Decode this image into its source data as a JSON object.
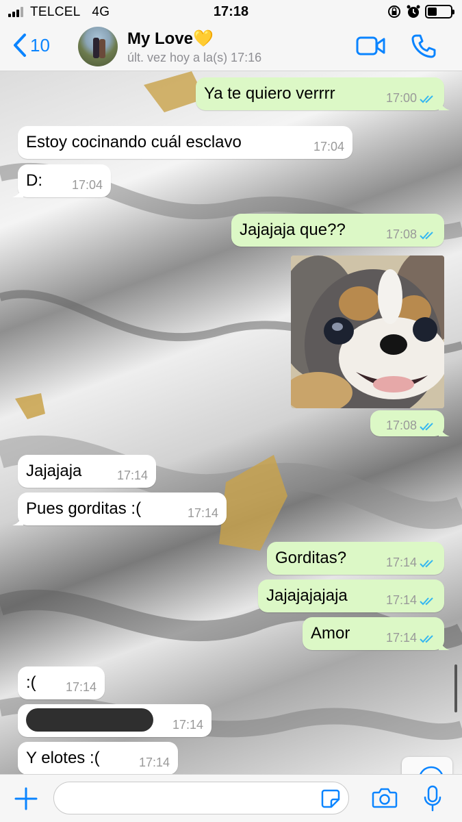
{
  "status_bar": {
    "carrier": "TELCEL",
    "network": "4G",
    "time": "17:18",
    "battery_level": 0.3
  },
  "header": {
    "back_count": "10",
    "contact_name": "My Love💛",
    "last_seen": "últ. vez hoy a la(s) 17:16",
    "icons": [
      "chevron-left-icon",
      "video-call-icon",
      "phone-call-icon"
    ]
  },
  "messages": [
    {
      "dir": "out",
      "text": "Ya te quiero verrrr",
      "time": "17:00",
      "read": true
    },
    {
      "dir": "in",
      "text": "Estoy cocinando cuál esclavo",
      "time": "17:04"
    },
    {
      "dir": "in",
      "text": "D:",
      "time": "17:04"
    },
    {
      "dir": "out",
      "text": "Jajajaja que??",
      "time": "17:08",
      "read": true
    },
    {
      "dir": "out",
      "type": "image",
      "time": "17:08",
      "read": true
    },
    {
      "dir": "in",
      "text": "Jajajaja",
      "time": "17:14"
    },
    {
      "dir": "in",
      "text": "Pues gorditas :(",
      "time": "17:14"
    },
    {
      "dir": "out",
      "text": "Gorditas?",
      "time": "17:14",
      "read": true
    },
    {
      "dir": "out",
      "text": "Jajajajajaja",
      "time": "17:14",
      "read": true
    },
    {
      "dir": "out",
      "text": "Amor",
      "time": "17:14",
      "read": true
    },
    {
      "dir": "in",
      "text": ":(",
      "time": "17:14"
    },
    {
      "dir": "in",
      "type": "redacted",
      "time": "17:14"
    },
    {
      "dir": "in",
      "text": "Y elotes :(",
      "time": "17:14"
    }
  ],
  "input_bar": {
    "placeholder": "",
    "icons": [
      "plus-icon",
      "sticker-icon",
      "camera-icon",
      "microphone-icon"
    ]
  },
  "colors": {
    "accent": "#0a84ff",
    "incoming_bubble": "#ffffff",
    "outgoing_bubble": "#dcf8c6",
    "read_ticks": "#34b7f1"
  }
}
